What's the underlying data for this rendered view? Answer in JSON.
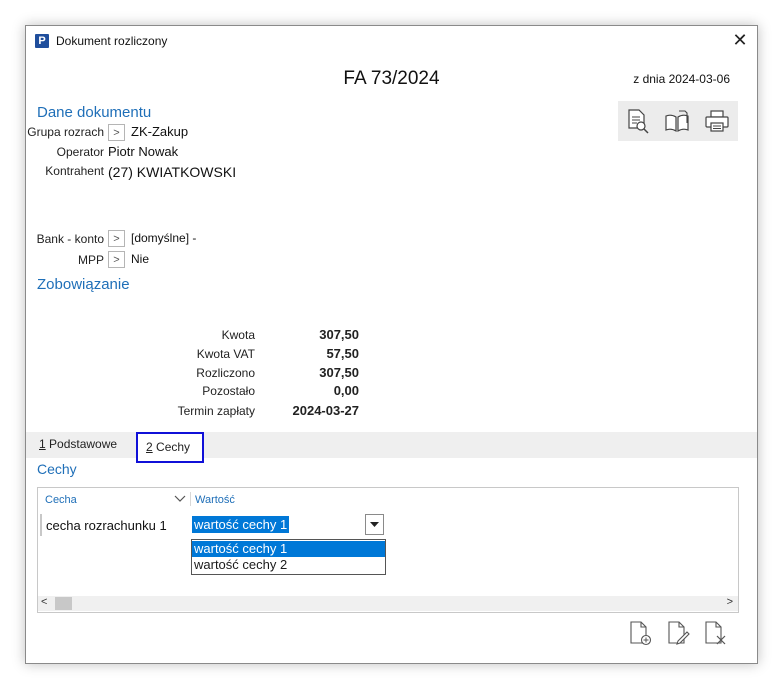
{
  "window": {
    "title": "Dokument rozliczony",
    "app_icon_letter": "P",
    "close_glyph": "✕"
  },
  "header": {
    "doc_number": "FA 73/2024",
    "date": "z dnia 2024-03-06"
  },
  "sections": {
    "dane": "Dane dokumentu",
    "zobowiazanie": "Zobowiązanie",
    "cechy": "Cechy"
  },
  "toolbar": {
    "icons": [
      "preview-document-icon",
      "open-book-icon",
      "print-icon"
    ]
  },
  "fields": {
    "grupa_label": "Grupa rozrach",
    "grupa_value": "ZK-Zakup",
    "operator_label": "Operator",
    "operator_value": "Piotr Nowak",
    "kontrahent_label": "Kontrahent",
    "kontrahent_value": "(27) KWIATKOWSKI",
    "bank_label": "Bank - konto",
    "bank_value": "[domyślne]  -",
    "mpp_label": "MPP",
    "mpp_value": "Nie",
    "arrow_glyph": ">"
  },
  "financial": {
    "kwota_label": "Kwota",
    "kwota_value": "307,50",
    "kwota_vat_label": "Kwota VAT",
    "kwota_vat_value": "57,50",
    "rozliczono_label": "Rozliczono",
    "rozliczono_value": "307,50",
    "pozostalo_label": "Pozostało",
    "pozostalo_value": "0,00",
    "termin_label": "Termin zapłaty",
    "termin_value": "2024-03-27"
  },
  "tabs": [
    {
      "key": "1",
      "label": " Podstawowe"
    },
    {
      "key": "2",
      "label": " Cechy"
    }
  ],
  "grid": {
    "col_cecha": "Cecha",
    "col_wartosc": "Wartość",
    "row_cecha": "cecha rozrachunku 1",
    "row_wartosc": "wartość cechy 1",
    "options": [
      "wartość cechy 1",
      "wartość cechy 2"
    ],
    "scroll_left": "<",
    "scroll_right": ">"
  },
  "bottom_actions": {
    "icons": [
      "add-document-icon",
      "edit-document-icon",
      "delete-document-icon"
    ]
  },
  "colors": {
    "accent": "#1f6fb8",
    "selection": "#0078d7",
    "active_tab_border": "#1010d8"
  }
}
